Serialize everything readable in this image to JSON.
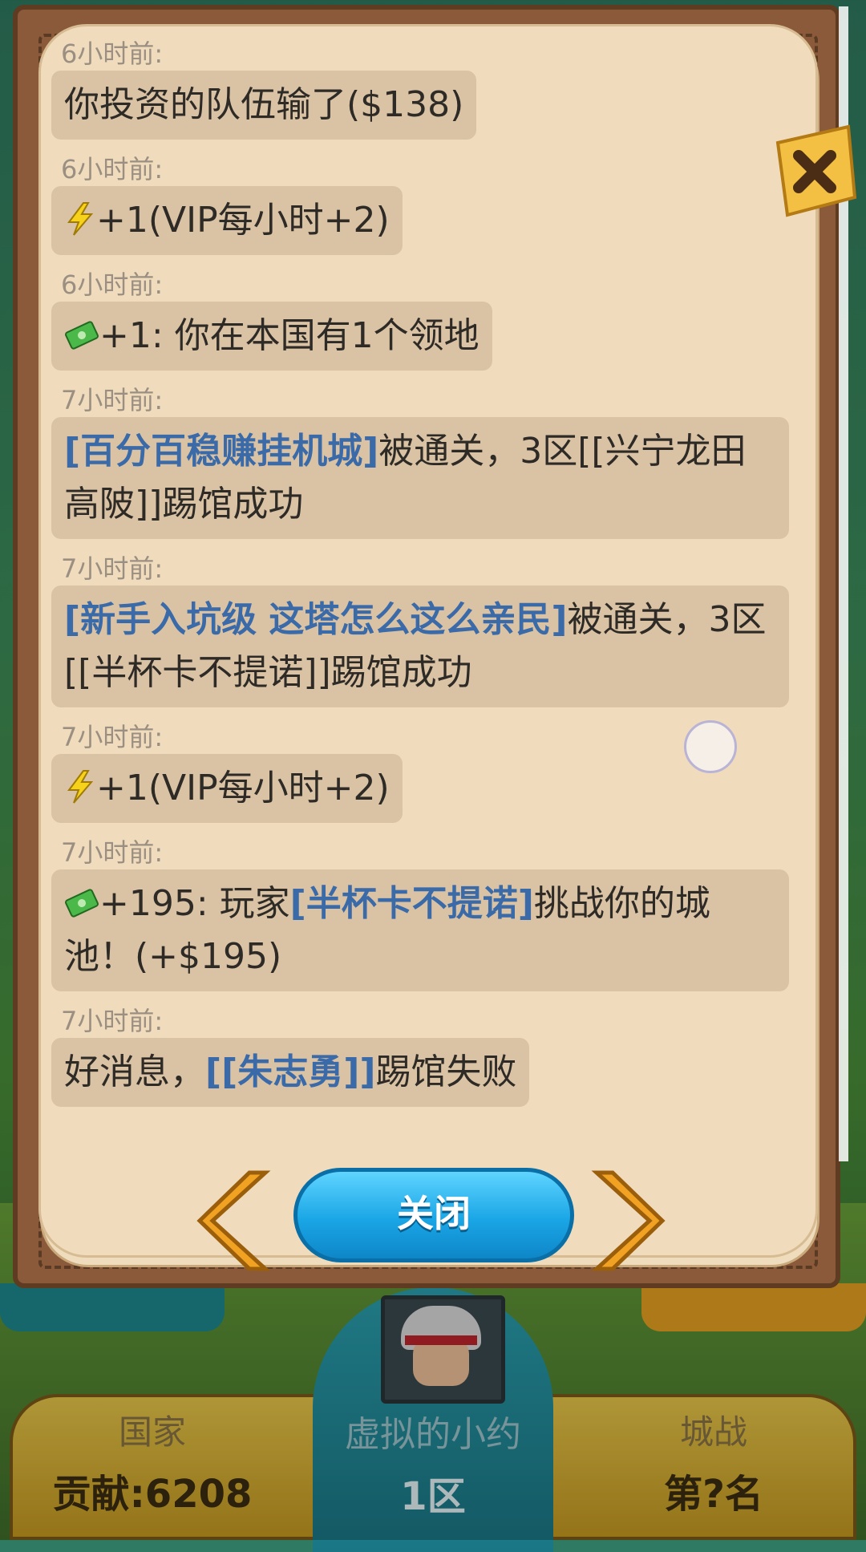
{
  "background_bar": {
    "left_title": "国家",
    "left_value": "贡献:6208",
    "center_title": "虚拟的小约",
    "center_value": "1区",
    "right_title": "城战",
    "right_value": "第?名"
  },
  "log": {
    "entries": [
      {
        "time": "6小时前:",
        "parts": [
          {
            "text": "你投资的队伍输了($138)"
          }
        ]
      },
      {
        "time": "6小时前:",
        "icon": "lightning-icon",
        "parts": [
          {
            "text": "+1(VIP每小时+2)"
          }
        ]
      },
      {
        "time": "6小时前:",
        "icon": "cash-icon",
        "parts": [
          {
            "text": "+1: 你在本国有1个领地"
          }
        ]
      },
      {
        "time": "7小时前:",
        "parts": [
          {
            "text": "[百分百稳赚挂机城]",
            "hl": true
          },
          {
            "text": "被通关，3区[[兴宁龙田高陂]]踢馆成功"
          }
        ]
      },
      {
        "time": "7小时前:",
        "parts": [
          {
            "text": "[新手入坑级 这塔怎么这么亲民]",
            "hl": true
          },
          {
            "text": "被通关，3区[[半杯卡不提诺]]踢馆成功"
          }
        ]
      },
      {
        "time": "7小时前:",
        "icon": "lightning-icon",
        "parts": [
          {
            "text": "+1(VIP每小时+2)"
          }
        ]
      },
      {
        "time": "7小时前:",
        "icon": "cash-icon",
        "parts": [
          {
            "text": "+195: 玩家"
          },
          {
            "text": "[半杯卡不提诺]",
            "hl": true
          },
          {
            "text": "挑战你的城池！(+$195)"
          }
        ]
      },
      {
        "time": "7小时前:",
        "parts": [
          {
            "text": "好消息，"
          },
          {
            "text": "[[朱志勇]]",
            "hl": true
          },
          {
            "text": "踢馆失败"
          }
        ]
      }
    ]
  },
  "buttons": {
    "close_label": "关闭"
  },
  "colors": {
    "highlight": "#3b6aa8",
    "paper": "#f0dcbd",
    "close_button": "#1aa6e6",
    "arrow": "#f2a223"
  }
}
